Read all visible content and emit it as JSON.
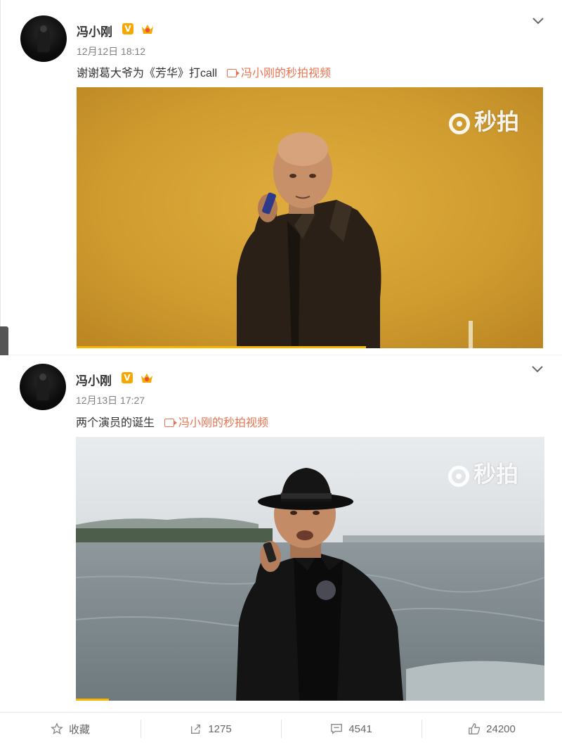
{
  "posts": [
    {
      "author": "冯小刚",
      "verified_badge": "V",
      "time": "12月12日 18:12",
      "text": "谢谢葛大爷为《芳华》打call",
      "video_link": "冯小刚的秒拍视频",
      "watermark": "秒拍",
      "progress": 0.62
    },
    {
      "author": "冯小刚",
      "verified_badge": "V",
      "time": "12月13日 17:27",
      "text": "两个演员的诞生",
      "video_link": "冯小刚的秒拍视频",
      "watermark": "秒拍",
      "progress": 0.07
    }
  ],
  "actions": {
    "favorite": "收藏",
    "repost": "1275",
    "comment": "4541",
    "like": "24200"
  },
  "colors": {
    "accent": "#eb7350",
    "verified": "#f7a800",
    "progress": "#f7b500"
  }
}
